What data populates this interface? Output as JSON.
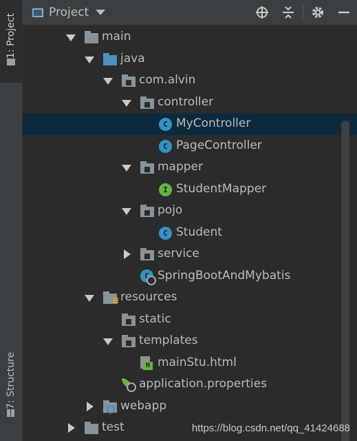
{
  "stripe": {
    "project_tab": "1: Project",
    "structure_tab": "7: Structure"
  },
  "header": {
    "title": "Project",
    "icons": [
      "project-window-icon",
      "locate-icon",
      "collapse-all-icon",
      "gear-icon",
      "minimize-icon"
    ]
  },
  "tree": [
    {
      "label": "main",
      "depth": 0,
      "arrow": "down",
      "icon": "folder"
    },
    {
      "label": "java",
      "depth": 1,
      "arrow": "down",
      "icon": "folder-blue"
    },
    {
      "label": "com.alvin",
      "depth": 2,
      "arrow": "down",
      "icon": "package"
    },
    {
      "label": "controller",
      "depth": 3,
      "arrow": "down",
      "icon": "package"
    },
    {
      "label": "MyController",
      "depth": 4,
      "arrow": "",
      "icon": "class",
      "selected": true
    },
    {
      "label": "PageController",
      "depth": 4,
      "arrow": "",
      "icon": "class"
    },
    {
      "label": "mapper",
      "depth": 3,
      "arrow": "down",
      "icon": "package"
    },
    {
      "label": "StudentMapper",
      "depth": 4,
      "arrow": "",
      "icon": "interface"
    },
    {
      "label": "pojo",
      "depth": 3,
      "arrow": "down",
      "icon": "package"
    },
    {
      "label": "Student",
      "depth": 4,
      "arrow": "",
      "icon": "class"
    },
    {
      "label": "service",
      "depth": 3,
      "arrow": "right",
      "icon": "package"
    },
    {
      "label": "SpringBootAndMybatis",
      "depth": 3,
      "arrow": "",
      "icon": "spring-boot-class"
    },
    {
      "label": "resources",
      "depth": 1,
      "arrow": "down",
      "icon": "resources-folder"
    },
    {
      "label": "static",
      "depth": 2,
      "arrow": "",
      "icon": "package"
    },
    {
      "label": "templates",
      "depth": 2,
      "arrow": "down",
      "icon": "package"
    },
    {
      "label": "mainStu.html",
      "depth": 3,
      "arrow": "",
      "icon": "html-file"
    },
    {
      "label": "application.properties",
      "depth": 2,
      "arrow": "",
      "icon": "spring-properties"
    },
    {
      "label": "webapp",
      "depth": 1,
      "arrow": "right",
      "icon": "web-folder"
    },
    {
      "label": "test",
      "depth": 0,
      "arrow": "right",
      "icon": "folder"
    }
  ],
  "watermark": "https://blog.csdn.net/qq_41424688",
  "colors": {
    "background": "#2b2b2b",
    "panel": "#3c3f41",
    "selection": "#0d293e",
    "class_badge": "#3592c4",
    "interface_badge": "#62b543",
    "text": "#bbbbbb"
  }
}
